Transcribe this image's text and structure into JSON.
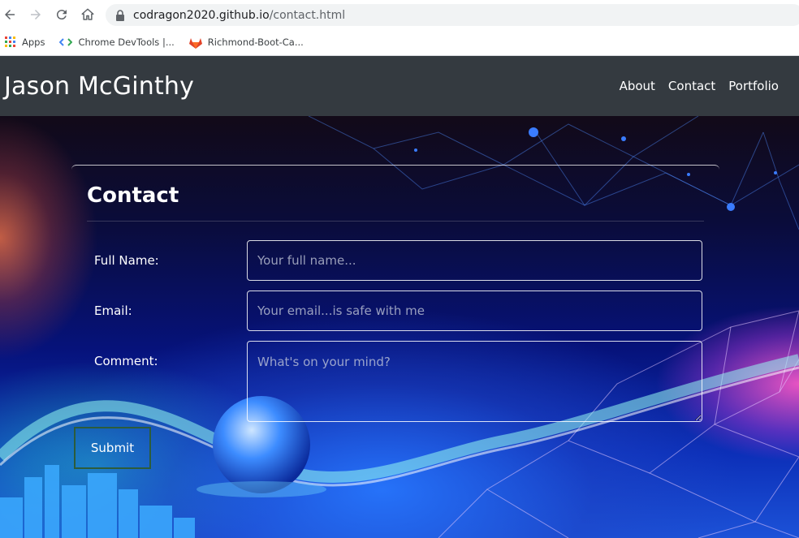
{
  "browser": {
    "url_host": "codragon2020.github.io",
    "url_path": "/contact.html",
    "bookmarks": [
      {
        "label": "Apps",
        "icon": "apps-grid-icon"
      },
      {
        "label": "Chrome DevTools  |...",
        "icon": "devtools-icon"
      },
      {
        "label": "Richmond-Boot-Ca...",
        "icon": "gitlab-icon"
      }
    ]
  },
  "site": {
    "brand": "Jason McGinthy",
    "nav": [
      {
        "label": "About"
      },
      {
        "label": "Contact"
      },
      {
        "label": "Portfolio"
      }
    ]
  },
  "contact": {
    "title": "Contact",
    "fields": [
      {
        "label": "Full Name:",
        "placeholder": "Your full name...",
        "value": ""
      },
      {
        "label": "Email:",
        "placeholder": "Your email...is safe with me",
        "value": ""
      },
      {
        "label": "Comment:",
        "placeholder": "What's on your mind?",
        "value": ""
      }
    ],
    "submit_label": "Submit"
  },
  "colors": {
    "navbar": "#343a40",
    "browser_bar": "#f1f3f4",
    "submit_border": "#2c5c3c"
  }
}
